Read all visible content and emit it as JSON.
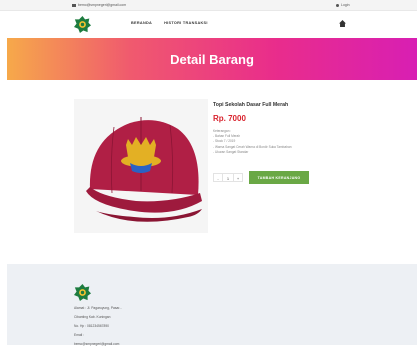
{
  "topbar": {
    "email": "bemo@smpnegeri@gmail.com",
    "login_label": "Login"
  },
  "nav": {
    "items": [
      {
        "label": "BERANDA"
      },
      {
        "label": "HISTORI TRANSAKSI"
      }
    ]
  },
  "hero": {
    "title": "Detail Barang"
  },
  "product": {
    "name": "Topi Sekolah Dasar Full Merah",
    "price": "Rp. 7000",
    "description_lines": [
      "Keterangan :",
      "- Bahan Full Merah",
      "- Stock 7 / 2019",
      "- Warna Sangat Cerah Warna di Bordir Suka Tambahan",
      "- Ukuran Sangat Standar"
    ],
    "qty_minus": "-",
    "qty_value": "1",
    "qty_plus": "+",
    "add_button_label": "TAMBAH KERANJANG"
  },
  "footer": {
    "lines": [
      "Alamat : Jl. Pagaruyung, Pasar...",
      "Cibanting Kab. Kuningan",
      "No. Hp : 081234567890",
      "Email :",
      "bemo@smpnegeri@gmail.com"
    ]
  },
  "colors": {
    "accent_green": "#6aa845",
    "price_red": "#d9232e",
    "hero_gradient_start": "#f6a94a",
    "hero_gradient_end": "#d81fb3"
  }
}
